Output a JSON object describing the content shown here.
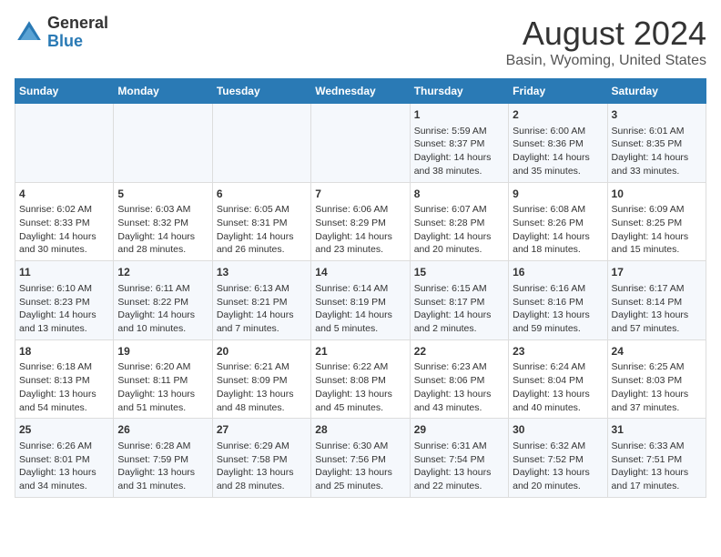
{
  "header": {
    "logo_general": "General",
    "logo_blue": "Blue",
    "main_title": "August 2024",
    "subtitle": "Basin, Wyoming, United States"
  },
  "calendar": {
    "days_of_week": [
      "Sunday",
      "Monday",
      "Tuesday",
      "Wednesday",
      "Thursday",
      "Friday",
      "Saturday"
    ],
    "weeks": [
      [
        {
          "day": "",
          "info": ""
        },
        {
          "day": "",
          "info": ""
        },
        {
          "day": "",
          "info": ""
        },
        {
          "day": "",
          "info": ""
        },
        {
          "day": "1",
          "info": "Sunrise: 5:59 AM\nSunset: 8:37 PM\nDaylight: 14 hours\nand 38 minutes."
        },
        {
          "day": "2",
          "info": "Sunrise: 6:00 AM\nSunset: 8:36 PM\nDaylight: 14 hours\nand 35 minutes."
        },
        {
          "day": "3",
          "info": "Sunrise: 6:01 AM\nSunset: 8:35 PM\nDaylight: 14 hours\nand 33 minutes."
        }
      ],
      [
        {
          "day": "4",
          "info": "Sunrise: 6:02 AM\nSunset: 8:33 PM\nDaylight: 14 hours\nand 30 minutes."
        },
        {
          "day": "5",
          "info": "Sunrise: 6:03 AM\nSunset: 8:32 PM\nDaylight: 14 hours\nand 28 minutes."
        },
        {
          "day": "6",
          "info": "Sunrise: 6:05 AM\nSunset: 8:31 PM\nDaylight: 14 hours\nand 26 minutes."
        },
        {
          "day": "7",
          "info": "Sunrise: 6:06 AM\nSunset: 8:29 PM\nDaylight: 14 hours\nand 23 minutes."
        },
        {
          "day": "8",
          "info": "Sunrise: 6:07 AM\nSunset: 8:28 PM\nDaylight: 14 hours\nand 20 minutes."
        },
        {
          "day": "9",
          "info": "Sunrise: 6:08 AM\nSunset: 8:26 PM\nDaylight: 14 hours\nand 18 minutes."
        },
        {
          "day": "10",
          "info": "Sunrise: 6:09 AM\nSunset: 8:25 PM\nDaylight: 14 hours\nand 15 minutes."
        }
      ],
      [
        {
          "day": "11",
          "info": "Sunrise: 6:10 AM\nSunset: 8:23 PM\nDaylight: 14 hours\nand 13 minutes."
        },
        {
          "day": "12",
          "info": "Sunrise: 6:11 AM\nSunset: 8:22 PM\nDaylight: 14 hours\nand 10 minutes."
        },
        {
          "day": "13",
          "info": "Sunrise: 6:13 AM\nSunset: 8:21 PM\nDaylight: 14 hours\nand 7 minutes."
        },
        {
          "day": "14",
          "info": "Sunrise: 6:14 AM\nSunset: 8:19 PM\nDaylight: 14 hours\nand 5 minutes."
        },
        {
          "day": "15",
          "info": "Sunrise: 6:15 AM\nSunset: 8:17 PM\nDaylight: 14 hours\nand 2 minutes."
        },
        {
          "day": "16",
          "info": "Sunrise: 6:16 AM\nSunset: 8:16 PM\nDaylight: 13 hours\nand 59 minutes."
        },
        {
          "day": "17",
          "info": "Sunrise: 6:17 AM\nSunset: 8:14 PM\nDaylight: 13 hours\nand 57 minutes."
        }
      ],
      [
        {
          "day": "18",
          "info": "Sunrise: 6:18 AM\nSunset: 8:13 PM\nDaylight: 13 hours\nand 54 minutes."
        },
        {
          "day": "19",
          "info": "Sunrise: 6:20 AM\nSunset: 8:11 PM\nDaylight: 13 hours\nand 51 minutes."
        },
        {
          "day": "20",
          "info": "Sunrise: 6:21 AM\nSunset: 8:09 PM\nDaylight: 13 hours\nand 48 minutes."
        },
        {
          "day": "21",
          "info": "Sunrise: 6:22 AM\nSunset: 8:08 PM\nDaylight: 13 hours\nand 45 minutes."
        },
        {
          "day": "22",
          "info": "Sunrise: 6:23 AM\nSunset: 8:06 PM\nDaylight: 13 hours\nand 43 minutes."
        },
        {
          "day": "23",
          "info": "Sunrise: 6:24 AM\nSunset: 8:04 PM\nDaylight: 13 hours\nand 40 minutes."
        },
        {
          "day": "24",
          "info": "Sunrise: 6:25 AM\nSunset: 8:03 PM\nDaylight: 13 hours\nand 37 minutes."
        }
      ],
      [
        {
          "day": "25",
          "info": "Sunrise: 6:26 AM\nSunset: 8:01 PM\nDaylight: 13 hours\nand 34 minutes."
        },
        {
          "day": "26",
          "info": "Sunrise: 6:28 AM\nSunset: 7:59 PM\nDaylight: 13 hours\nand 31 minutes."
        },
        {
          "day": "27",
          "info": "Sunrise: 6:29 AM\nSunset: 7:58 PM\nDaylight: 13 hours\nand 28 minutes."
        },
        {
          "day": "28",
          "info": "Sunrise: 6:30 AM\nSunset: 7:56 PM\nDaylight: 13 hours\nand 25 minutes."
        },
        {
          "day": "29",
          "info": "Sunrise: 6:31 AM\nSunset: 7:54 PM\nDaylight: 13 hours\nand 22 minutes."
        },
        {
          "day": "30",
          "info": "Sunrise: 6:32 AM\nSunset: 7:52 PM\nDaylight: 13 hours\nand 20 minutes."
        },
        {
          "day": "31",
          "info": "Sunrise: 6:33 AM\nSunset: 7:51 PM\nDaylight: 13 hours\nand 17 minutes."
        }
      ]
    ]
  }
}
